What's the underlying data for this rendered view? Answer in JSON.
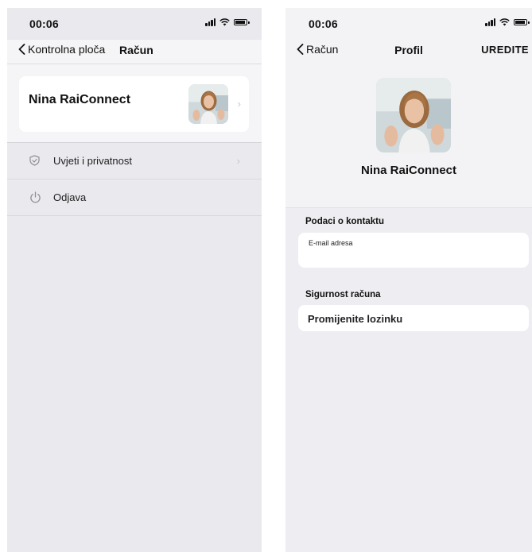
{
  "left_screen": {
    "status_time": "00:06",
    "back_label": "Kontrolna ploča",
    "title": "Račun",
    "profile_name": "Nina RaiConnect",
    "menu": [
      {
        "label": "Uvjeti i privatnost",
        "icon": "shield-icon",
        "has_chevron": true
      },
      {
        "label": "Odjava",
        "icon": "power-icon",
        "has_chevron": false
      }
    ]
  },
  "right_screen": {
    "status_time": "00:06",
    "back_label": "Račun",
    "title": "Profil",
    "action_label": "UREDITE",
    "profile_name": "Nina RaiConnect",
    "contact_section_label": "Podaci o kontaktu",
    "email_caption": "E-mail adresa",
    "email_value": "",
    "security_section_label": "Sigurnost računa",
    "change_password_label": "Promijenite lozinku"
  }
}
